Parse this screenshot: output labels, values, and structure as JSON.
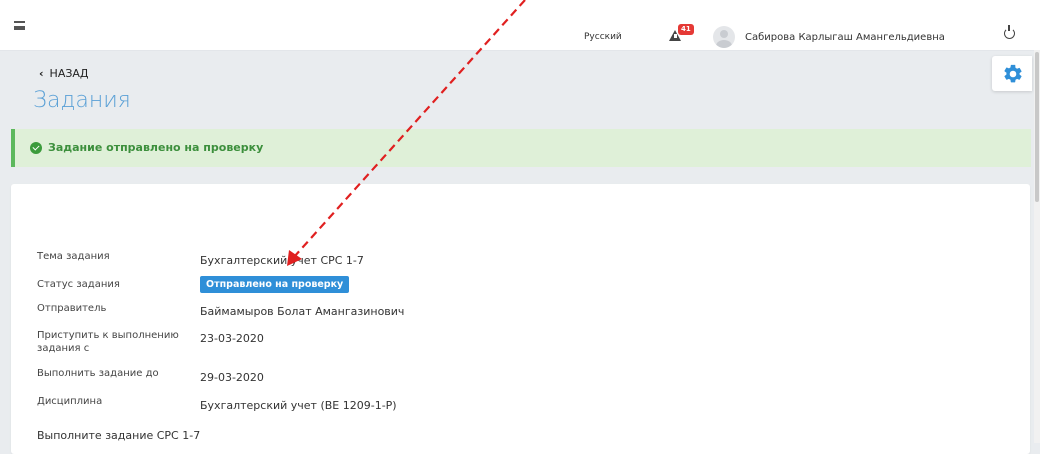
{
  "header": {
    "language": "Русский",
    "notification_count": "41",
    "user_name": "Сабирова Карлыгаш Амангельдиевна"
  },
  "nav": {
    "back_label": "НАЗАД",
    "page_title": "Задания"
  },
  "alert": {
    "message": "Задание отправлено на проверку",
    "color": "#3c8f3c"
  },
  "details": {
    "topic_label": "Тема задания",
    "topic_value": "Бухгалтерский учет СРС 1-7",
    "status_label": "Статус задания",
    "status_value": "Отправлено на проверку",
    "sender_label": "Отправитель",
    "sender_value": "Баймамыров Болат Амангазинович",
    "start_label_line1": "Приступить к выполнению",
    "start_label_line2": "задания с",
    "start_value": "23-03-2020",
    "due_label": "Выполнить задание до",
    "due_value": "29-03-2020",
    "discipline_label": "Дисциплина",
    "discipline_value": "Бухгалтерский учет (BE 1209-1-P)"
  },
  "footer_text": "Выполните задание СРС 1-7",
  "colors": {
    "accent": "#5aa0d6",
    "status_badge": "#2f8fd8",
    "annotation_arrow": "#e02020"
  }
}
